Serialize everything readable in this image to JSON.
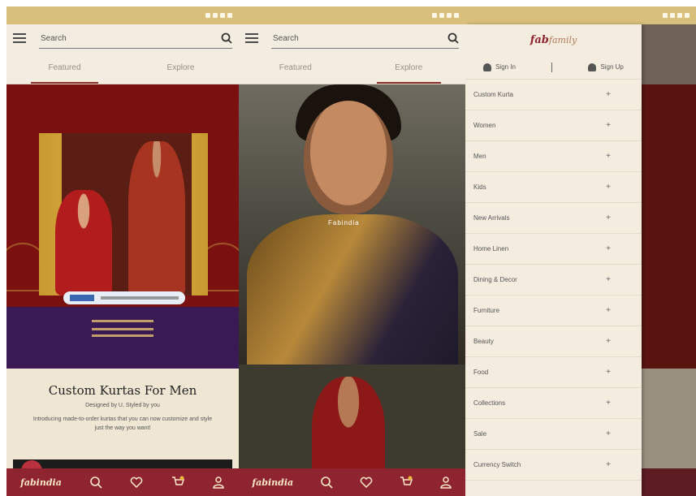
{
  "colors": {
    "statusbar": "#d9bf7c",
    "brand": "#8e2430",
    "background": "#f3ece0",
    "banner_red": "#7b1010",
    "banner_purple": "#3a1a55"
  },
  "search": {
    "placeholder": "Search"
  },
  "tabs": [
    "Featured",
    "Explore"
  ],
  "banner": {
    "heading": "Custom Kurtas For Men",
    "subheading": "Designed by U, Styled by you",
    "description": "Introducing made-to-order kurtas that you can now customize and style just the way you want!",
    "overlay_word": "Fabindia"
  },
  "bottom_nav": {
    "logo": "fabindia",
    "icons": [
      "search-icon",
      "heart-icon",
      "cart-icon",
      "user-icon"
    ]
  },
  "drawer": {
    "logo_main": "fab",
    "logo_suffix": "family",
    "sign_in": "Sign In",
    "sign_up": "Sign Up",
    "items": [
      "Custom Kurta",
      "Women",
      "Men",
      "Kids",
      "New Arrivals",
      "Home Linen",
      "Dining & Decor",
      "Furniture",
      "Beauty",
      "Food",
      "Collections",
      "Sale",
      "Currency Switch"
    ],
    "expand_symbol": "+"
  }
}
